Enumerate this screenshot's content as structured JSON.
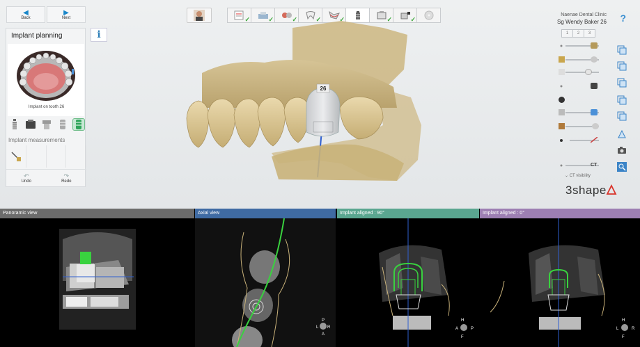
{
  "nav": {
    "back_label": "Back",
    "next_label": "Next"
  },
  "panel": {
    "title": "Implant planning",
    "jaw_caption": "Implant on tooth 26",
    "measurements_title": "Implant measurements",
    "undo_label": "Undo",
    "redo_label": "Redo"
  },
  "header": {
    "clinic": "Naenae Dental Clinic",
    "patient": "Sg Wendy Baker 26"
  },
  "view_tabs": [
    "1",
    "2",
    "3"
  ],
  "ct_visibility_label": "CT visibility",
  "logo_text": "3shape",
  "scene": {
    "tooth_label": "26"
  },
  "colors": {
    "accent": "#1a87c9",
    "check": "#37a537",
    "implant_green": "#39d23f",
    "axis_blue": "#2f5fd0",
    "bone_gold": "#c9b27a"
  },
  "bottom_views": {
    "panoramic": "Panoramic view",
    "axial": "Axial view",
    "aligned_90": "Implant aligned : 90°",
    "aligned_0": "Implant aligned : 0°"
  },
  "orientation": {
    "axial": [
      "P",
      "L",
      "R",
      "A"
    ],
    "aligned_90": [
      "H",
      "A",
      "P",
      "F"
    ],
    "aligned_0": [
      "H",
      "L",
      "R",
      "F"
    ]
  }
}
